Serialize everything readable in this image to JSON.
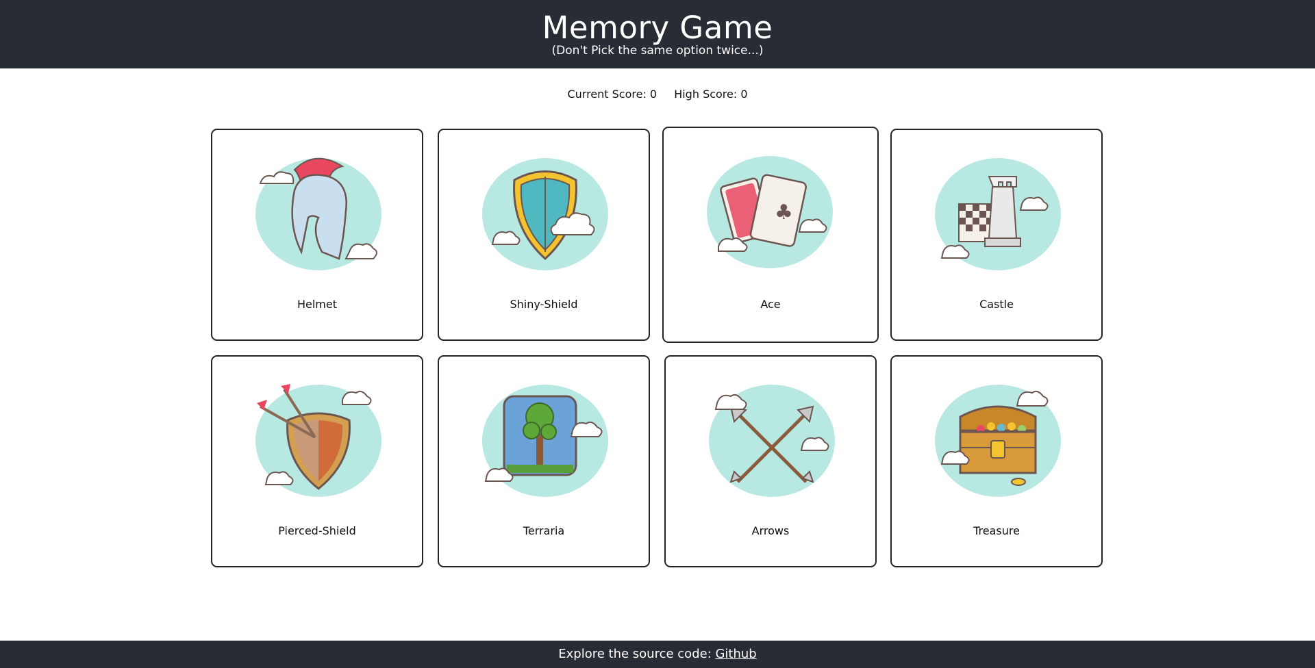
{
  "header": {
    "title": "Memory Game",
    "subtitle": "(Don't Pick the same option twice...)"
  },
  "scores": {
    "current_label": "Current Score: 0",
    "high_label": "High Score: 0"
  },
  "cards": [
    {
      "label": "Helmet",
      "icon": "helmet-icon"
    },
    {
      "label": "Shiny-Shield",
      "icon": "shiny-shield-icon"
    },
    {
      "label": "Ace",
      "icon": "ace-cards-icon"
    },
    {
      "label": "Castle",
      "icon": "castle-rook-icon"
    },
    {
      "label": "Pierced-Shield",
      "icon": "pierced-shield-icon"
    },
    {
      "label": "Terraria",
      "icon": "terraria-tree-icon"
    },
    {
      "label": "Arrows",
      "icon": "crossed-arrows-icon"
    },
    {
      "label": "Treasure",
      "icon": "treasure-chest-icon"
    }
  ],
  "footer": {
    "text": "Explore the source code: ",
    "link_label": "Github"
  },
  "colors": {
    "header_bg": "#282c34",
    "cloud_bg": "#b8e8e2",
    "card_border": "#222222"
  }
}
